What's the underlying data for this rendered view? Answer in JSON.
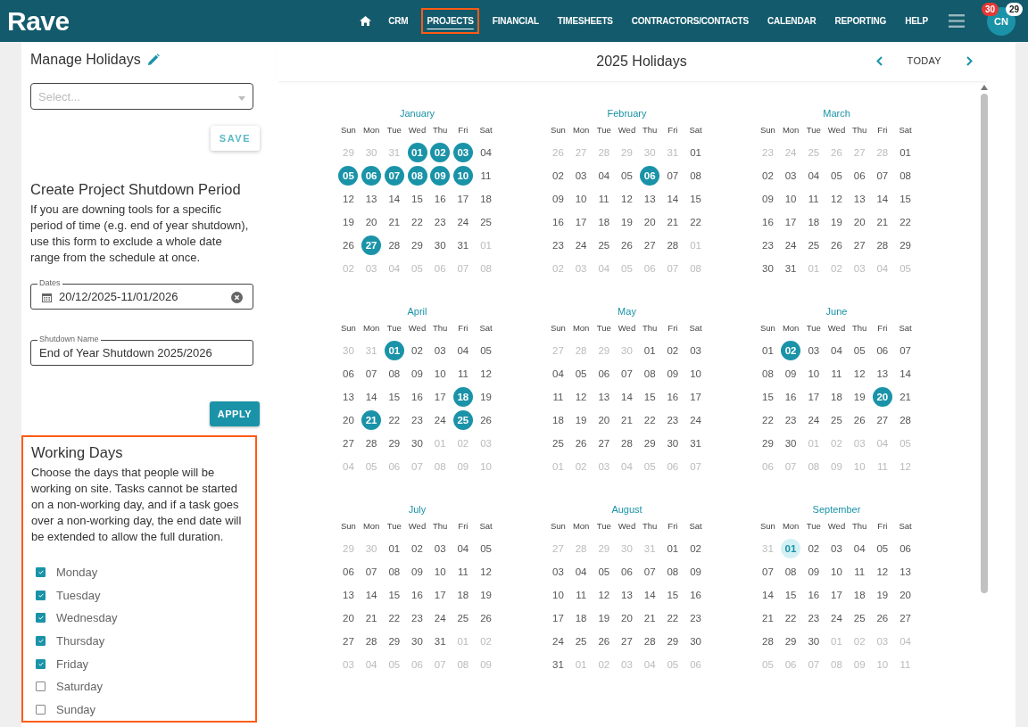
{
  "header": {
    "logo": "Rave",
    "nav": [
      {
        "label": "CRM",
        "selected": false,
        "highlighted": false
      },
      {
        "label": "PROJECTS",
        "selected": true,
        "highlighted": true
      },
      {
        "label": "FINANCIAL",
        "selected": false,
        "highlighted": false
      },
      {
        "label": "TIMESHEETS",
        "selected": false,
        "highlighted": false
      },
      {
        "label": "CONTRACTORS/CONTACTS",
        "selected": false,
        "highlighted": false
      },
      {
        "label": "CALENDAR",
        "selected": false,
        "highlighted": false
      },
      {
        "label": "REPORTING",
        "selected": false,
        "highlighted": false
      },
      {
        "label": "HELP",
        "selected": false,
        "highlighted": false
      }
    ],
    "avatar": "CN",
    "notifications": "30",
    "messages": "29"
  },
  "manage": {
    "title": "Manage Holidays",
    "select_placeholder": "Select...",
    "save": "SAVE"
  },
  "shutdown": {
    "title": "Create Project Shutdown Period",
    "description": "If you are downing tools for a specific period of time (e.g. end of year shutdown), use this form to exclude a whole date range from the schedule at once.",
    "dates_label": "Dates",
    "dates_value": "20/12/2025-11/01/2026",
    "name_label": "Shutdown Name",
    "name_value": "End of Year Shutdown 2025/2026",
    "apply": "APPLY"
  },
  "working_days": {
    "title": "Working Days",
    "highlighted": true,
    "description": "Choose the days that people will be working on site. Tasks cannot be started on a non-working day, and if a task goes over a non-working day, the end date will be extended to allow the full duration.",
    "days": [
      {
        "label": "Monday",
        "checked": true
      },
      {
        "label": "Tuesday",
        "checked": true
      },
      {
        "label": "Wednesday",
        "checked": true
      },
      {
        "label": "Thursday",
        "checked": true
      },
      {
        "label": "Friday",
        "checked": true
      },
      {
        "label": "Saturday",
        "checked": false
      },
      {
        "label": "Sunday",
        "checked": false
      }
    ]
  },
  "calendar": {
    "title": "2025 Holidays",
    "today": "TODAY",
    "months": [
      {
        "name": "January",
        "weekdays": [
          "Sun",
          "Mon",
          "Tue",
          "Wed",
          "Thu",
          "Fri",
          "Sat"
        ],
        "weeks": [
          [
            {
              "n": "29",
              "kind": "out"
            },
            {
              "n": "30",
              "kind": "out"
            },
            {
              "n": "31",
              "kind": "out"
            },
            {
              "n": "01",
              "kind": "holiday"
            },
            {
              "n": "02",
              "kind": "holiday"
            },
            {
              "n": "03",
              "kind": "holiday"
            },
            {
              "n": "04",
              "kind": "day"
            }
          ],
          [
            {
              "n": "05",
              "kind": "holiday"
            },
            {
              "n": "06",
              "kind": "holiday"
            },
            {
              "n": "07",
              "kind": "holiday"
            },
            {
              "n": "08",
              "kind": "holiday"
            },
            {
              "n": "09",
              "kind": "holiday"
            },
            {
              "n": "10",
              "kind": "holiday"
            },
            {
              "n": "11",
              "kind": "day"
            }
          ],
          [
            {
              "n": "12",
              "kind": "day"
            },
            {
              "n": "13",
              "kind": "day"
            },
            {
              "n": "14",
              "kind": "day"
            },
            {
              "n": "15",
              "kind": "day"
            },
            {
              "n": "16",
              "kind": "day"
            },
            {
              "n": "17",
              "kind": "day"
            },
            {
              "n": "18",
              "kind": "day"
            }
          ],
          [
            {
              "n": "19",
              "kind": "day"
            },
            {
              "n": "20",
              "kind": "day"
            },
            {
              "n": "21",
              "kind": "day"
            },
            {
              "n": "22",
              "kind": "day"
            },
            {
              "n": "23",
              "kind": "day"
            },
            {
              "n": "24",
              "kind": "day"
            },
            {
              "n": "25",
              "kind": "day"
            }
          ],
          [
            {
              "n": "26",
              "kind": "day"
            },
            {
              "n": "27",
              "kind": "holiday"
            },
            {
              "n": "28",
              "kind": "day"
            },
            {
              "n": "29",
              "kind": "day"
            },
            {
              "n": "30",
              "kind": "day"
            },
            {
              "n": "31",
              "kind": "day"
            },
            {
              "n": "01",
              "kind": "out"
            }
          ],
          [
            {
              "n": "02",
              "kind": "out"
            },
            {
              "n": "03",
              "kind": "out"
            },
            {
              "n": "04",
              "kind": "out"
            },
            {
              "n": "05",
              "kind": "out"
            },
            {
              "n": "06",
              "kind": "out"
            },
            {
              "n": "07",
              "kind": "out"
            },
            {
              "n": "08",
              "kind": "out"
            }
          ]
        ]
      },
      {
        "name": "February",
        "weekdays": [
          "Sun",
          "Mon",
          "Tue",
          "Wed",
          "Thu",
          "Fri",
          "Sat"
        ],
        "weeks": [
          [
            {
              "n": "26",
              "kind": "out"
            },
            {
              "n": "27",
              "kind": "out"
            },
            {
              "n": "28",
              "kind": "out"
            },
            {
              "n": "29",
              "kind": "out"
            },
            {
              "n": "30",
              "kind": "out"
            },
            {
              "n": "31",
              "kind": "out"
            },
            {
              "n": "01",
              "kind": "day"
            }
          ],
          [
            {
              "n": "02",
              "kind": "day"
            },
            {
              "n": "03",
              "kind": "day"
            },
            {
              "n": "04",
              "kind": "day"
            },
            {
              "n": "05",
              "kind": "day"
            },
            {
              "n": "06",
              "kind": "holiday"
            },
            {
              "n": "07",
              "kind": "day"
            },
            {
              "n": "08",
              "kind": "day"
            }
          ],
          [
            {
              "n": "09",
              "kind": "day"
            },
            {
              "n": "10",
              "kind": "day"
            },
            {
              "n": "11",
              "kind": "day"
            },
            {
              "n": "12",
              "kind": "day"
            },
            {
              "n": "13",
              "kind": "day"
            },
            {
              "n": "14",
              "kind": "day"
            },
            {
              "n": "15",
              "kind": "day"
            }
          ],
          [
            {
              "n": "16",
              "kind": "day"
            },
            {
              "n": "17",
              "kind": "day"
            },
            {
              "n": "18",
              "kind": "day"
            },
            {
              "n": "19",
              "kind": "day"
            },
            {
              "n": "20",
              "kind": "day"
            },
            {
              "n": "21",
              "kind": "day"
            },
            {
              "n": "22",
              "kind": "day"
            }
          ],
          [
            {
              "n": "23",
              "kind": "day"
            },
            {
              "n": "24",
              "kind": "day"
            },
            {
              "n": "25",
              "kind": "day"
            },
            {
              "n": "26",
              "kind": "day"
            },
            {
              "n": "27",
              "kind": "day"
            },
            {
              "n": "28",
              "kind": "day"
            },
            {
              "n": "01",
              "kind": "out"
            }
          ],
          [
            {
              "n": "02",
              "kind": "out"
            },
            {
              "n": "03",
              "kind": "out"
            },
            {
              "n": "04",
              "kind": "out"
            },
            {
              "n": "05",
              "kind": "out"
            },
            {
              "n": "06",
              "kind": "out"
            },
            {
              "n": "07",
              "kind": "out"
            },
            {
              "n": "08",
              "kind": "out"
            }
          ]
        ]
      },
      {
        "name": "March",
        "weekdays": [
          "Sun",
          "Mon",
          "Tue",
          "Wed",
          "Thu",
          "Fri",
          "Sat"
        ],
        "weeks": [
          [
            {
              "n": "23",
              "kind": "out"
            },
            {
              "n": "24",
              "kind": "out"
            },
            {
              "n": "25",
              "kind": "out"
            },
            {
              "n": "26",
              "kind": "out"
            },
            {
              "n": "27",
              "kind": "out"
            },
            {
              "n": "28",
              "kind": "out"
            },
            {
              "n": "01",
              "kind": "day"
            }
          ],
          [
            {
              "n": "02",
              "kind": "day"
            },
            {
              "n": "03",
              "kind": "day"
            },
            {
              "n": "04",
              "kind": "day"
            },
            {
              "n": "05",
              "kind": "day"
            },
            {
              "n": "06",
              "kind": "day"
            },
            {
              "n": "07",
              "kind": "day"
            },
            {
              "n": "08",
              "kind": "day"
            }
          ],
          [
            {
              "n": "09",
              "kind": "day"
            },
            {
              "n": "10",
              "kind": "day"
            },
            {
              "n": "11",
              "kind": "day"
            },
            {
              "n": "12",
              "kind": "day"
            },
            {
              "n": "13",
              "kind": "day"
            },
            {
              "n": "14",
              "kind": "day"
            },
            {
              "n": "15",
              "kind": "day"
            }
          ],
          [
            {
              "n": "16",
              "kind": "day"
            },
            {
              "n": "17",
              "kind": "day"
            },
            {
              "n": "18",
              "kind": "day"
            },
            {
              "n": "19",
              "kind": "day"
            },
            {
              "n": "20",
              "kind": "day"
            },
            {
              "n": "21",
              "kind": "day"
            },
            {
              "n": "22",
              "kind": "day"
            }
          ],
          [
            {
              "n": "23",
              "kind": "day"
            },
            {
              "n": "24",
              "kind": "day"
            },
            {
              "n": "25",
              "kind": "day"
            },
            {
              "n": "26",
              "kind": "day"
            },
            {
              "n": "27",
              "kind": "day"
            },
            {
              "n": "28",
              "kind": "day"
            },
            {
              "n": "29",
              "kind": "day"
            }
          ],
          [
            {
              "n": "30",
              "kind": "day"
            },
            {
              "n": "31",
              "kind": "day"
            },
            {
              "n": "01",
              "kind": "out"
            },
            {
              "n": "02",
              "kind": "out"
            },
            {
              "n": "03",
              "kind": "out"
            },
            {
              "n": "04",
              "kind": "out"
            },
            {
              "n": "05",
              "kind": "out"
            }
          ]
        ]
      },
      {
        "name": "April",
        "weekdays": [
          "Sun",
          "Mon",
          "Tue",
          "Wed",
          "Thu",
          "Fri",
          "Sat"
        ],
        "weeks": [
          [
            {
              "n": "30",
              "kind": "out"
            },
            {
              "n": "31",
              "kind": "out"
            },
            {
              "n": "01",
              "kind": "holiday"
            },
            {
              "n": "02",
              "kind": "day"
            },
            {
              "n": "03",
              "kind": "day"
            },
            {
              "n": "04",
              "kind": "day"
            },
            {
              "n": "05",
              "kind": "day"
            }
          ],
          [
            {
              "n": "06",
              "kind": "day"
            },
            {
              "n": "07",
              "kind": "day"
            },
            {
              "n": "08",
              "kind": "day"
            },
            {
              "n": "09",
              "kind": "day"
            },
            {
              "n": "10",
              "kind": "day"
            },
            {
              "n": "11",
              "kind": "day"
            },
            {
              "n": "12",
              "kind": "day"
            }
          ],
          [
            {
              "n": "13",
              "kind": "day"
            },
            {
              "n": "14",
              "kind": "day"
            },
            {
              "n": "15",
              "kind": "day"
            },
            {
              "n": "16",
              "kind": "day"
            },
            {
              "n": "17",
              "kind": "day"
            },
            {
              "n": "18",
              "kind": "holiday"
            },
            {
              "n": "19",
              "kind": "day"
            }
          ],
          [
            {
              "n": "20",
              "kind": "day"
            },
            {
              "n": "21",
              "kind": "holiday"
            },
            {
              "n": "22",
              "kind": "day"
            },
            {
              "n": "23",
              "kind": "day"
            },
            {
              "n": "24",
              "kind": "day"
            },
            {
              "n": "25",
              "kind": "holiday"
            },
            {
              "n": "26",
              "kind": "day"
            }
          ],
          [
            {
              "n": "27",
              "kind": "day"
            },
            {
              "n": "28",
              "kind": "day"
            },
            {
              "n": "29",
              "kind": "day"
            },
            {
              "n": "30",
              "kind": "day"
            },
            {
              "n": "01",
              "kind": "out"
            },
            {
              "n": "02",
              "kind": "out"
            },
            {
              "n": "03",
              "kind": "out"
            }
          ],
          [
            {
              "n": "04",
              "kind": "out"
            },
            {
              "n": "05",
              "kind": "out"
            },
            {
              "n": "06",
              "kind": "out"
            },
            {
              "n": "07",
              "kind": "out"
            },
            {
              "n": "08",
              "kind": "out"
            },
            {
              "n": "09",
              "kind": "out"
            },
            {
              "n": "10",
              "kind": "out"
            }
          ]
        ]
      },
      {
        "name": "May",
        "weekdays": [
          "Sun",
          "Mon",
          "Tue",
          "Wed",
          "Thu",
          "Fri",
          "Sat"
        ],
        "weeks": [
          [
            {
              "n": "27",
              "kind": "out"
            },
            {
              "n": "28",
              "kind": "out"
            },
            {
              "n": "29",
              "kind": "out"
            },
            {
              "n": "30",
              "kind": "out"
            },
            {
              "n": "01",
              "kind": "day"
            },
            {
              "n": "02",
              "kind": "day"
            },
            {
              "n": "03",
              "kind": "day"
            }
          ],
          [
            {
              "n": "04",
              "kind": "day"
            },
            {
              "n": "05",
              "kind": "day"
            },
            {
              "n": "06",
              "kind": "day"
            },
            {
              "n": "07",
              "kind": "day"
            },
            {
              "n": "08",
              "kind": "day"
            },
            {
              "n": "09",
              "kind": "day"
            },
            {
              "n": "10",
              "kind": "day"
            }
          ],
          [
            {
              "n": "11",
              "kind": "day"
            },
            {
              "n": "12",
              "kind": "day"
            },
            {
              "n": "13",
              "kind": "day"
            },
            {
              "n": "14",
              "kind": "day"
            },
            {
              "n": "15",
              "kind": "day"
            },
            {
              "n": "16",
              "kind": "day"
            },
            {
              "n": "17",
              "kind": "day"
            }
          ],
          [
            {
              "n": "18",
              "kind": "day"
            },
            {
              "n": "19",
              "kind": "day"
            },
            {
              "n": "20",
              "kind": "day"
            },
            {
              "n": "21",
              "kind": "day"
            },
            {
              "n": "22",
              "kind": "day"
            },
            {
              "n": "23",
              "kind": "day"
            },
            {
              "n": "24",
              "kind": "day"
            }
          ],
          [
            {
              "n": "25",
              "kind": "day"
            },
            {
              "n": "26",
              "kind": "day"
            },
            {
              "n": "27",
              "kind": "day"
            },
            {
              "n": "28",
              "kind": "day"
            },
            {
              "n": "29",
              "kind": "day"
            },
            {
              "n": "30",
              "kind": "day"
            },
            {
              "n": "31",
              "kind": "day"
            }
          ],
          [
            {
              "n": "01",
              "kind": "out"
            },
            {
              "n": "02",
              "kind": "out"
            },
            {
              "n": "03",
              "kind": "out"
            },
            {
              "n": "04",
              "kind": "out"
            },
            {
              "n": "05",
              "kind": "out"
            },
            {
              "n": "06",
              "kind": "out"
            },
            {
              "n": "07",
              "kind": "out"
            }
          ]
        ]
      },
      {
        "name": "June",
        "weekdays": [
          "Sun",
          "Mon",
          "Tue",
          "Wed",
          "Thu",
          "Fri",
          "Sat"
        ],
        "weeks": [
          [
            {
              "n": "01",
              "kind": "day"
            },
            {
              "n": "02",
              "kind": "holiday"
            },
            {
              "n": "03",
              "kind": "day"
            },
            {
              "n": "04",
              "kind": "day"
            },
            {
              "n": "05",
              "kind": "day"
            },
            {
              "n": "06",
              "kind": "day"
            },
            {
              "n": "07",
              "kind": "day"
            }
          ],
          [
            {
              "n": "08",
              "kind": "day"
            },
            {
              "n": "09",
              "kind": "day"
            },
            {
              "n": "10",
              "kind": "day"
            },
            {
              "n": "11",
              "kind": "day"
            },
            {
              "n": "12",
              "kind": "day"
            },
            {
              "n": "13",
              "kind": "day"
            },
            {
              "n": "14",
              "kind": "day"
            }
          ],
          [
            {
              "n": "15",
              "kind": "day"
            },
            {
              "n": "16",
              "kind": "day"
            },
            {
              "n": "17",
              "kind": "day"
            },
            {
              "n": "18",
              "kind": "day"
            },
            {
              "n": "19",
              "kind": "day"
            },
            {
              "n": "20",
              "kind": "holiday"
            },
            {
              "n": "21",
              "kind": "day"
            }
          ],
          [
            {
              "n": "22",
              "kind": "day"
            },
            {
              "n": "23",
              "kind": "day"
            },
            {
              "n": "24",
              "kind": "day"
            },
            {
              "n": "25",
              "kind": "day"
            },
            {
              "n": "26",
              "kind": "day"
            },
            {
              "n": "27",
              "kind": "day"
            },
            {
              "n": "28",
              "kind": "day"
            }
          ],
          [
            {
              "n": "29",
              "kind": "day"
            },
            {
              "n": "30",
              "kind": "day"
            },
            {
              "n": "01",
              "kind": "out"
            },
            {
              "n": "02",
              "kind": "out"
            },
            {
              "n": "03",
              "kind": "out"
            },
            {
              "n": "04",
              "kind": "out"
            },
            {
              "n": "05",
              "kind": "out"
            }
          ],
          [
            {
              "n": "06",
              "kind": "out"
            },
            {
              "n": "07",
              "kind": "out"
            },
            {
              "n": "08",
              "kind": "out"
            },
            {
              "n": "09",
              "kind": "out"
            },
            {
              "n": "10",
              "kind": "out"
            },
            {
              "n": "11",
              "kind": "out"
            },
            {
              "n": "12",
              "kind": "out"
            }
          ]
        ]
      },
      {
        "name": "July",
        "weekdays": [
          "Sun",
          "Mon",
          "Tue",
          "Wed",
          "Thu",
          "Fri",
          "Sat"
        ],
        "weeks": [
          [
            {
              "n": "29",
              "kind": "out"
            },
            {
              "n": "30",
              "kind": "out"
            },
            {
              "n": "01",
              "kind": "day"
            },
            {
              "n": "02",
              "kind": "day"
            },
            {
              "n": "03",
              "kind": "day"
            },
            {
              "n": "04",
              "kind": "day"
            },
            {
              "n": "05",
              "kind": "day"
            }
          ],
          [
            {
              "n": "06",
              "kind": "day"
            },
            {
              "n": "07",
              "kind": "day"
            },
            {
              "n": "08",
              "kind": "day"
            },
            {
              "n": "09",
              "kind": "day"
            },
            {
              "n": "10",
              "kind": "day"
            },
            {
              "n": "11",
              "kind": "day"
            },
            {
              "n": "12",
              "kind": "day"
            }
          ],
          [
            {
              "n": "13",
              "kind": "day"
            },
            {
              "n": "14",
              "kind": "day"
            },
            {
              "n": "15",
              "kind": "day"
            },
            {
              "n": "16",
              "kind": "day"
            },
            {
              "n": "17",
              "kind": "day"
            },
            {
              "n": "18",
              "kind": "day"
            },
            {
              "n": "19",
              "kind": "day"
            }
          ],
          [
            {
              "n": "20",
              "kind": "day"
            },
            {
              "n": "21",
              "kind": "day"
            },
            {
              "n": "22",
              "kind": "day"
            },
            {
              "n": "23",
              "kind": "day"
            },
            {
              "n": "24",
              "kind": "day"
            },
            {
              "n": "25",
              "kind": "day"
            },
            {
              "n": "26",
              "kind": "day"
            }
          ],
          [
            {
              "n": "27",
              "kind": "day"
            },
            {
              "n": "28",
              "kind": "day"
            },
            {
              "n": "29",
              "kind": "day"
            },
            {
              "n": "30",
              "kind": "day"
            },
            {
              "n": "31",
              "kind": "day"
            },
            {
              "n": "01",
              "kind": "out"
            },
            {
              "n": "02",
              "kind": "out"
            }
          ],
          [
            {
              "n": "03",
              "kind": "out"
            },
            {
              "n": "04",
              "kind": "out"
            },
            {
              "n": "05",
              "kind": "out"
            },
            {
              "n": "06",
              "kind": "out"
            },
            {
              "n": "07",
              "kind": "out"
            },
            {
              "n": "08",
              "kind": "out"
            },
            {
              "n": "09",
              "kind": "out"
            }
          ]
        ]
      },
      {
        "name": "August",
        "weekdays": [
          "Sun",
          "Mon",
          "Tue",
          "Wed",
          "Thu",
          "Fri",
          "Sat"
        ],
        "weeks": [
          [
            {
              "n": "27",
              "kind": "out"
            },
            {
              "n": "28",
              "kind": "out"
            },
            {
              "n": "29",
              "kind": "out"
            },
            {
              "n": "30",
              "kind": "out"
            },
            {
              "n": "31",
              "kind": "out"
            },
            {
              "n": "01",
              "kind": "day"
            },
            {
              "n": "02",
              "kind": "day"
            }
          ],
          [
            {
              "n": "03",
              "kind": "day"
            },
            {
              "n": "04",
              "kind": "day"
            },
            {
              "n": "05",
              "kind": "day"
            },
            {
              "n": "06",
              "kind": "day"
            },
            {
              "n": "07",
              "kind": "day"
            },
            {
              "n": "08",
              "kind": "day"
            },
            {
              "n": "09",
              "kind": "day"
            }
          ],
          [
            {
              "n": "10",
              "kind": "day"
            },
            {
              "n": "11",
              "kind": "day"
            },
            {
              "n": "12",
              "kind": "day"
            },
            {
              "n": "13",
              "kind": "day"
            },
            {
              "n": "14",
              "kind": "day"
            },
            {
              "n": "15",
              "kind": "day"
            },
            {
              "n": "16",
              "kind": "day"
            }
          ],
          [
            {
              "n": "17",
              "kind": "day"
            },
            {
              "n": "18",
              "kind": "day"
            },
            {
              "n": "19",
              "kind": "day"
            },
            {
              "n": "20",
              "kind": "day"
            },
            {
              "n": "21",
              "kind": "day"
            },
            {
              "n": "22",
              "kind": "day"
            },
            {
              "n": "23",
              "kind": "day"
            }
          ],
          [
            {
              "n": "24",
              "kind": "day"
            },
            {
              "n": "25",
              "kind": "day"
            },
            {
              "n": "26",
              "kind": "day"
            },
            {
              "n": "27",
              "kind": "day"
            },
            {
              "n": "28",
              "kind": "day"
            },
            {
              "n": "29",
              "kind": "day"
            },
            {
              "n": "30",
              "kind": "day"
            }
          ],
          [
            {
              "n": "31",
              "kind": "day"
            },
            {
              "n": "01",
              "kind": "out"
            },
            {
              "n": "02",
              "kind": "out"
            },
            {
              "n": "03",
              "kind": "out"
            },
            {
              "n": "04",
              "kind": "out"
            },
            {
              "n": "05",
              "kind": "out"
            },
            {
              "n": "06",
              "kind": "out"
            }
          ]
        ]
      },
      {
        "name": "September",
        "weekdays": [
          "Sun",
          "Mon",
          "Tue",
          "Wed",
          "Thu",
          "Fri",
          "Sat"
        ],
        "weeks": [
          [
            {
              "n": "31",
              "kind": "out"
            },
            {
              "n": "01",
              "kind": "today"
            },
            {
              "n": "02",
              "kind": "day"
            },
            {
              "n": "03",
              "kind": "day"
            },
            {
              "n": "04",
              "kind": "day"
            },
            {
              "n": "05",
              "kind": "day"
            },
            {
              "n": "06",
              "kind": "day"
            }
          ],
          [
            {
              "n": "07",
              "kind": "day"
            },
            {
              "n": "08",
              "kind": "day"
            },
            {
              "n": "09",
              "kind": "day"
            },
            {
              "n": "10",
              "kind": "day"
            },
            {
              "n": "11",
              "kind": "day"
            },
            {
              "n": "12",
              "kind": "day"
            },
            {
              "n": "13",
              "kind": "day"
            }
          ],
          [
            {
              "n": "14",
              "kind": "day"
            },
            {
              "n": "15",
              "kind": "day"
            },
            {
              "n": "16",
              "kind": "day"
            },
            {
              "n": "17",
              "kind": "day"
            },
            {
              "n": "18",
              "kind": "day"
            },
            {
              "n": "19",
              "kind": "day"
            },
            {
              "n": "20",
              "kind": "day"
            }
          ],
          [
            {
              "n": "21",
              "kind": "day"
            },
            {
              "n": "22",
              "kind": "day"
            },
            {
              "n": "23",
              "kind": "day"
            },
            {
              "n": "24",
              "kind": "day"
            },
            {
              "n": "25",
              "kind": "day"
            },
            {
              "n": "26",
              "kind": "day"
            },
            {
              "n": "27",
              "kind": "day"
            }
          ],
          [
            {
              "n": "28",
              "kind": "day"
            },
            {
              "n": "29",
              "kind": "day"
            },
            {
              "n": "30",
              "kind": "day"
            },
            {
              "n": "01",
              "kind": "out"
            },
            {
              "n": "02",
              "kind": "out"
            },
            {
              "n": "03",
              "kind": "out"
            },
            {
              "n": "04",
              "kind": "out"
            }
          ],
          [
            {
              "n": "05",
              "kind": "out"
            },
            {
              "n": "06",
              "kind": "out"
            },
            {
              "n": "07",
              "kind": "out"
            },
            {
              "n": "08",
              "kind": "out"
            },
            {
              "n": "09",
              "kind": "out"
            },
            {
              "n": "10",
              "kind": "out"
            },
            {
              "n": "11",
              "kind": "out"
            }
          ]
        ]
      }
    ]
  }
}
